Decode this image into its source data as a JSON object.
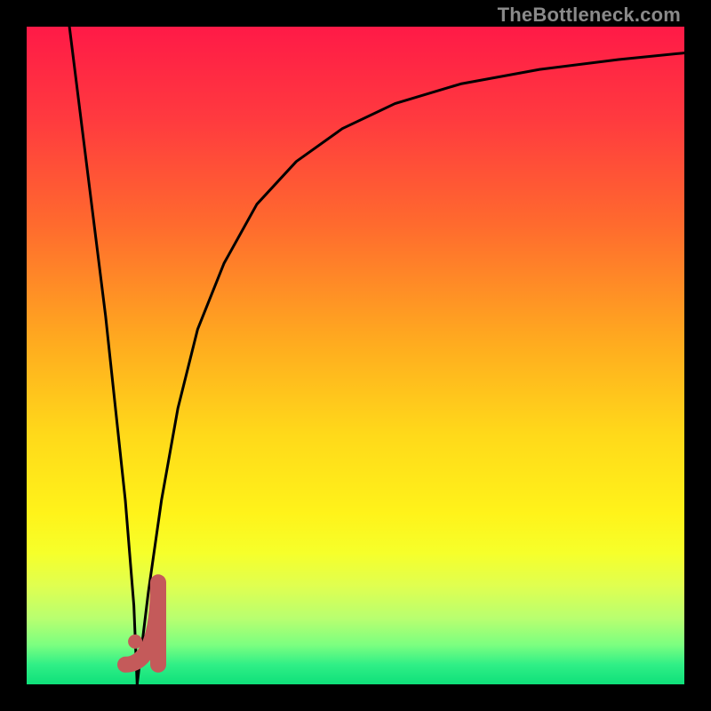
{
  "watermark": "TheBottleneck.com",
  "colors": {
    "frame": "#000000",
    "gradient_stops": [
      {
        "pct": 0,
        "color": "#ff1a47"
      },
      {
        "pct": 14,
        "color": "#ff3a3f"
      },
      {
        "pct": 30,
        "color": "#ff6a2e"
      },
      {
        "pct": 48,
        "color": "#ffab1f"
      },
      {
        "pct": 62,
        "color": "#ffd91a"
      },
      {
        "pct": 74,
        "color": "#fff31a"
      },
      {
        "pct": 80,
        "color": "#f6ff2a"
      },
      {
        "pct": 85,
        "color": "#e0ff50"
      },
      {
        "pct": 90,
        "color": "#b8ff70"
      },
      {
        "pct": 94,
        "color": "#7cff80"
      },
      {
        "pct": 97,
        "color": "#30ef86"
      },
      {
        "pct": 100,
        "color": "#0fe07a"
      }
    ],
    "curve": "#000000",
    "marker_stroke": "#c45a5a",
    "marker_fill": "#c45a5a"
  },
  "chart_data": {
    "type": "line",
    "title": "",
    "xlabel": "",
    "ylabel": "",
    "xlim": [
      0,
      100
    ],
    "ylim": [
      0,
      100
    ],
    "series": [
      {
        "name": "left-branch",
        "x": [
          6.5,
          7.5,
          9.0,
          10.5,
          12.0,
          13.5,
          15.0,
          16.3,
          16.8
        ],
        "y": [
          100,
          92,
          80,
          68,
          56,
          42,
          28,
          12,
          0
        ]
      },
      {
        "name": "right-branch",
        "x": [
          16.8,
          18.5,
          20.5,
          23.0,
          26.0,
          30.0,
          35.0,
          41.0,
          48.0,
          56.0,
          66.0,
          78.0,
          90.0,
          100.0
        ],
        "y": [
          0,
          14,
          28,
          42,
          54,
          64,
          73,
          79.5,
          84.5,
          88.3,
          91.3,
          93.5,
          95.0,
          96.0
        ]
      }
    ],
    "annotations": {
      "j_marker": {
        "dot": {
          "x": 16.5,
          "y": 6.5
        },
        "stroke_vertical": {
          "x1": 20.0,
          "y1": 3.0,
          "x2": 20.0,
          "y2": 15.5
        },
        "stroke_horizontal": {
          "x1": 15.0,
          "y1": 3.0,
          "x2": 20.0,
          "y2": 3.0
        }
      }
    }
  }
}
